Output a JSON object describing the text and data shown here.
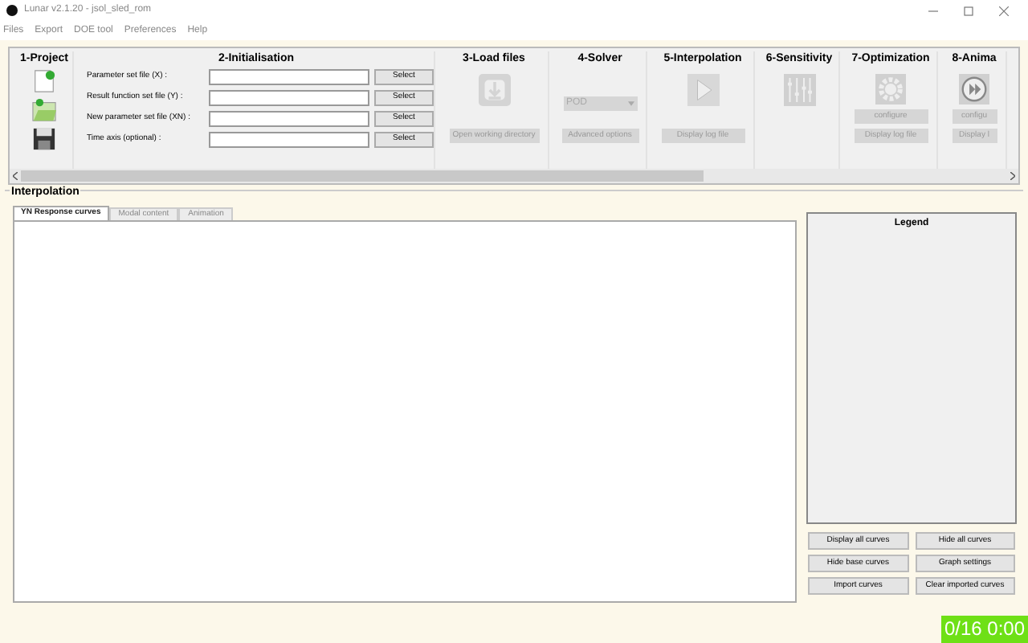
{
  "window": {
    "title": "Lunar v2.1.20 - jsol_sled_rom"
  },
  "menu": [
    "Files",
    "Export",
    "DOE tool",
    "Preferences",
    "Help"
  ],
  "toolbar": {
    "groups": [
      {
        "kind": "project",
        "title": "1-Project"
      },
      {
        "kind": "init",
        "title": "2-Initialisation",
        "rows": [
          {
            "label": "Parameter set file (X) :",
            "button": "Select"
          },
          {
            "label": "Result function set file (Y) :",
            "button": "Select"
          },
          {
            "label": "New parameter set file (XN) :",
            "button": "Select"
          },
          {
            "label": "Time axis (optional) :",
            "button": "Select"
          }
        ]
      },
      {
        "kind": "load",
        "title": "3-Load files",
        "buttons": [
          {
            "label": "Open working directory",
            "disabled": true
          }
        ]
      },
      {
        "kind": "solver",
        "title": "4-Solver",
        "dropdown": {
          "value": "POD",
          "disabled": true
        },
        "buttons": [
          {
            "label": "Advanced options",
            "disabled": true
          }
        ]
      },
      {
        "kind": "interpolation",
        "title": "5-Interpolation",
        "buttons": [
          {
            "label": "Display log file",
            "disabled": true
          }
        ]
      },
      {
        "kind": "sensitivity",
        "title": "6-Sensitivity"
      },
      {
        "kind": "optimization",
        "title": "7-Optimization",
        "buttons": [
          {
            "label": "configure",
            "disabled": true
          },
          {
            "label": "Display log file",
            "disabled": true
          }
        ]
      },
      {
        "kind": "animation",
        "title": "8-Anima",
        "buttons": [
          {
            "label": "configu",
            "disabled": true
          },
          {
            "label": "Display l",
            "disabled": true
          }
        ]
      }
    ]
  },
  "interpolation": {
    "title": "Interpolation",
    "tabs": [
      {
        "label": "YN Response curves",
        "selected": true
      },
      {
        "label": "Modal content",
        "selected": false
      },
      {
        "label": "Animation",
        "selected": false
      }
    ],
    "legend": {
      "title": "Legend"
    },
    "buttons": [
      "Display all curves",
      "Hide all curves",
      "Hide base curves",
      "Graph settings",
      "Import curves",
      "Clear imported curves"
    ]
  },
  "counter": "0/16 0:00"
}
